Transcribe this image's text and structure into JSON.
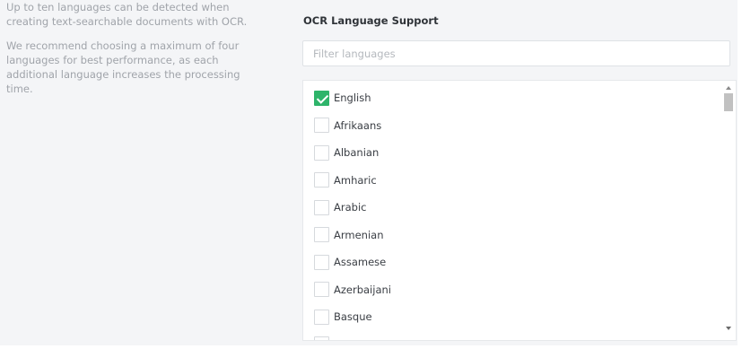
{
  "help": {
    "line1": "Up to ten languages can be detected when creating text-searchable documents with OCR.",
    "line2": "We recommend choosing a maximum of four languages for best performance, as each additional language increases the processing time."
  },
  "section": {
    "title": "OCR Language Support"
  },
  "filter": {
    "placeholder": "Filter languages",
    "value": ""
  },
  "languages": [
    {
      "label": "English",
      "checked": true
    },
    {
      "label": "Afrikaans",
      "checked": false
    },
    {
      "label": "Albanian",
      "checked": false
    },
    {
      "label": "Amharic",
      "checked": false
    },
    {
      "label": "Arabic",
      "checked": false
    },
    {
      "label": "Armenian",
      "checked": false
    },
    {
      "label": "Assamese",
      "checked": false
    },
    {
      "label": "Azerbaijani",
      "checked": false
    },
    {
      "label": "Basque",
      "checked": false
    },
    {
      "label": "",
      "checked": false
    }
  ],
  "colors": {
    "checked": "#2eb46a",
    "panel_bg": "#f4f5f7",
    "help_text": "#a0a4aa"
  }
}
